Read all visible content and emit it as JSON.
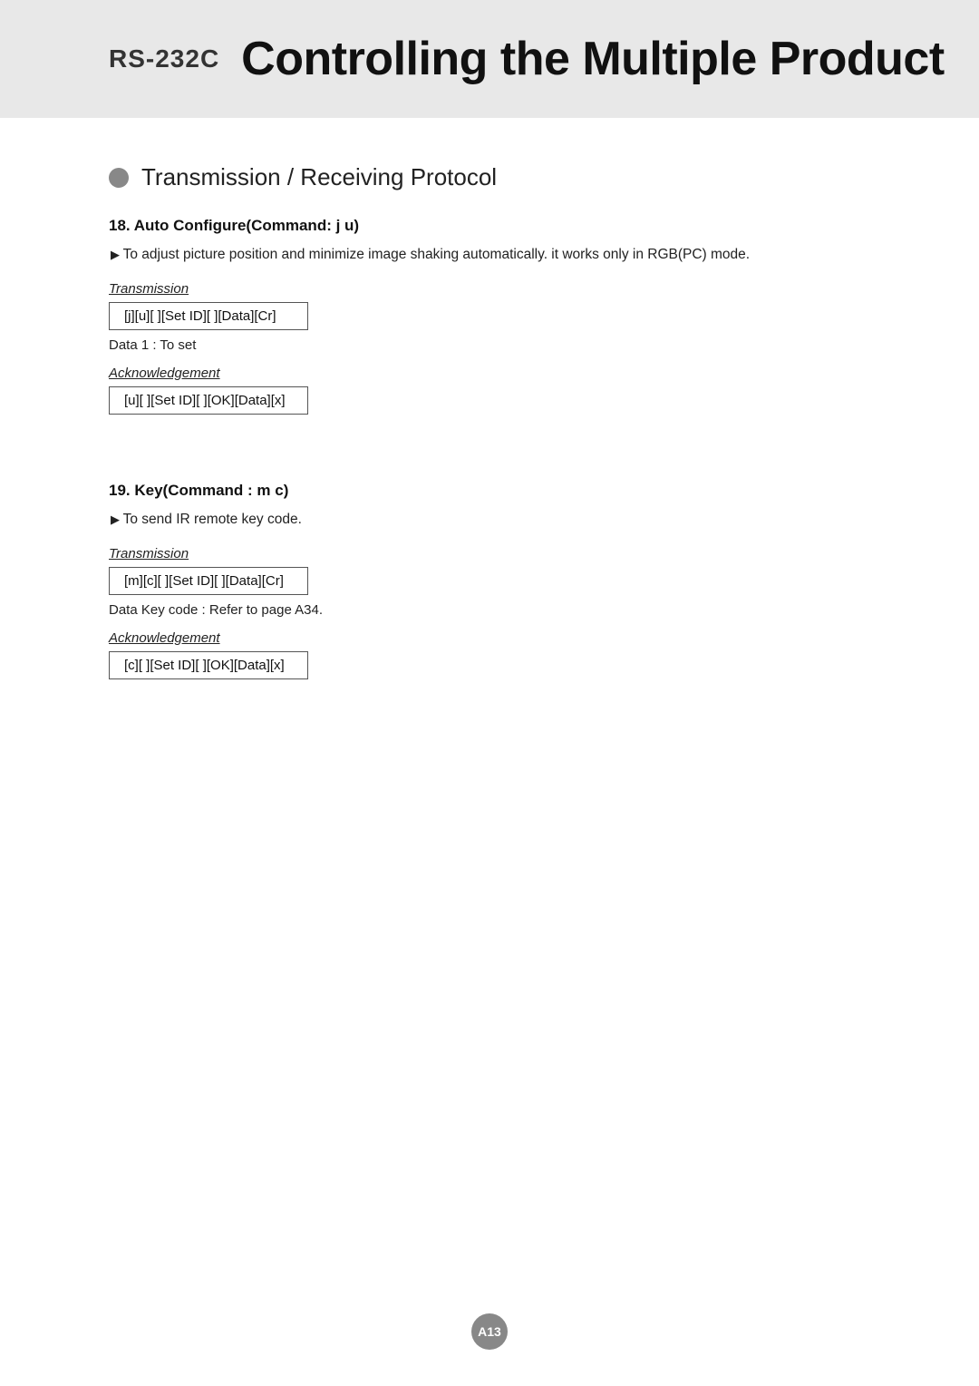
{
  "header": {
    "prefix": "RS-232C",
    "title": "Controlling the Multiple Product"
  },
  "section": {
    "title": "Transmission / Receiving Protocol"
  },
  "command18": {
    "heading": "18. Auto Configure(Command: j u)",
    "description": "To adjust picture position and minimize image shaking automatically. it works only in RGB(PC) mode.",
    "transmission_label": "Transmission",
    "transmission_code": "[j][u][  ][Set ID][  ][Data][Cr]",
    "data_note": "Data 1 : To set",
    "acknowledgement_label": "Acknowledgement",
    "acknowledgement_code": "[u][  ][Set ID][  ][OK][Data][x]"
  },
  "command19": {
    "heading": "19. Key(Command : m c)",
    "description": "To send IR remote key code.",
    "transmission_label": "Transmission",
    "transmission_code": "[m][c][  ][Set ID][  ][Data][Cr]",
    "data_note": "Data  Key code : Refer to page A34.",
    "acknowledgement_label": "Acknowledgement",
    "acknowledgement_code": "[c][  ][Set ID][  ][OK][Data][x]"
  },
  "page_number": "A13"
}
